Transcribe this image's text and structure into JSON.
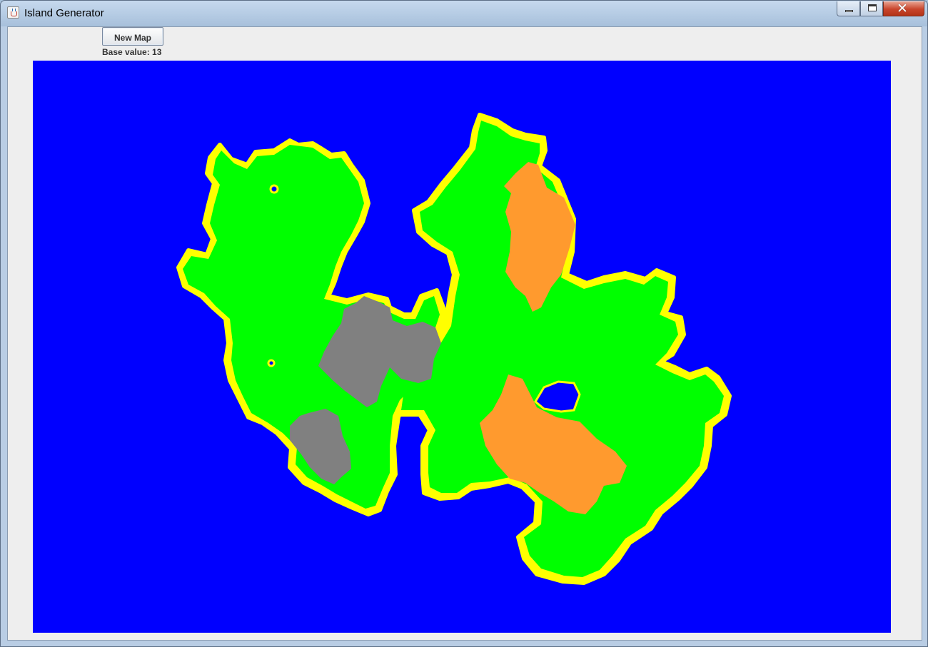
{
  "window": {
    "title": "Island Generator",
    "icon": "java-cup-icon"
  },
  "toolbar": {
    "new_map_label": "New Map",
    "base_value_text": "Base value: 13"
  },
  "map": {
    "colors": {
      "water": "#0000ff",
      "shore": "#ffff00",
      "grass": "#00ff00",
      "desert": "#ff9a2e",
      "mountain": "#808080"
    }
  }
}
